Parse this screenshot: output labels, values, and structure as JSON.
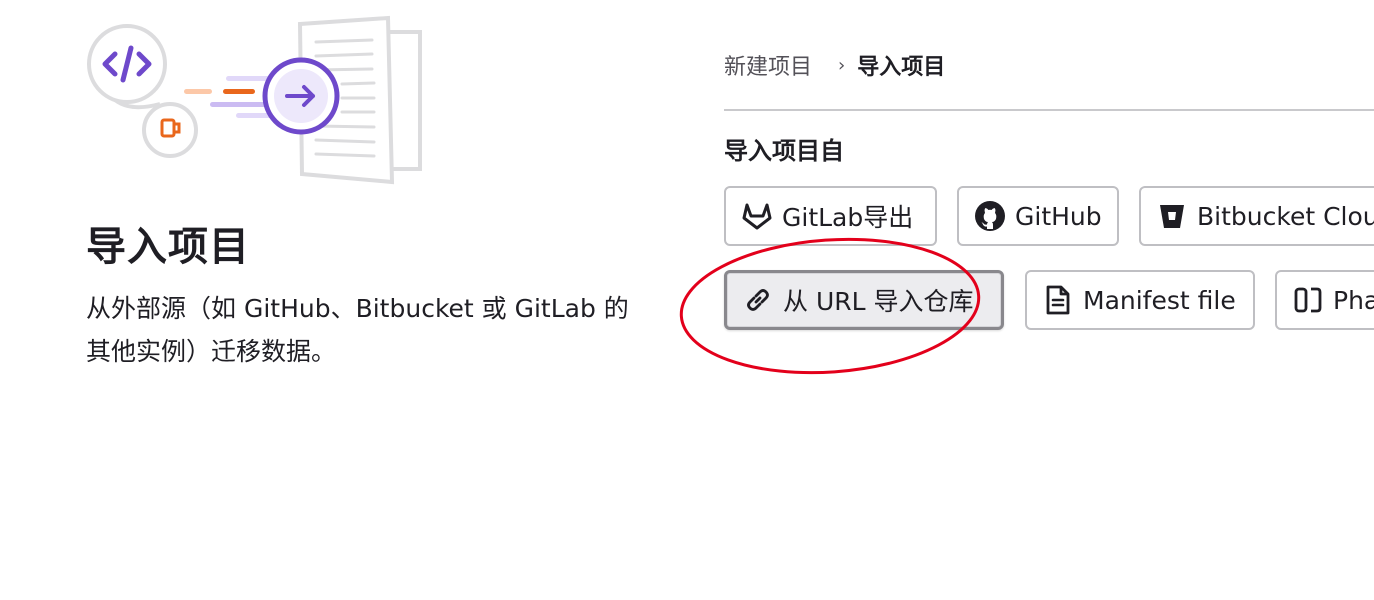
{
  "left": {
    "title": "导入项目",
    "description": "从外部源（如 GitHub、Bitbucket 或 GitLab 的其他实例）迁移数据。"
  },
  "breadcrumb": {
    "parent": "新建项目",
    "separator": "›",
    "current": "导入项目"
  },
  "import_section": {
    "label": "导入项目自",
    "sources": [
      {
        "label": "GitLab导出",
        "icon": "tanuki-icon"
      },
      {
        "label": "GitHub",
        "icon": "github-icon"
      },
      {
        "label": "Bitbucket Cloud",
        "icon": "bitbucket-icon"
      },
      {
        "label": "从 URL 导入仓库",
        "icon": "link-icon",
        "state": "pressed"
      },
      {
        "label": "Manifest file",
        "icon": "document-icon"
      },
      {
        "label": "Phabricator",
        "icon": "phabricator-icon"
      }
    ]
  },
  "colors": {
    "text": "#1f1e24",
    "muted": "#535158",
    "border": "#bfbfc3",
    "accent_purple": "#6e49cb",
    "accent_orange": "#e9671c",
    "annotation_red": "#e3001b"
  }
}
